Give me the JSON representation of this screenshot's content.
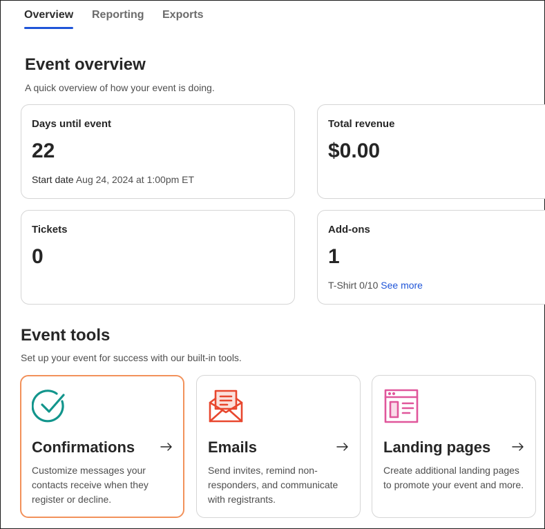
{
  "tabs": [
    {
      "label": "Overview",
      "active": true
    },
    {
      "label": "Reporting",
      "active": false
    },
    {
      "label": "Exports",
      "active": false
    }
  ],
  "overview": {
    "title": "Event overview",
    "subtitle": "A quick overview of how your event is doing.",
    "cards": {
      "days": {
        "label": "Days until event",
        "value": "22",
        "start_label": "Start date",
        "start_value": "Aug 24, 2024 at 1:00pm ET"
      },
      "revenue": {
        "label": "Total revenue",
        "value": "$0.00"
      },
      "tickets": {
        "label": "Tickets",
        "value": "0"
      },
      "addons": {
        "label": "Add-ons",
        "value": "1",
        "detail": "T-Shirt 0/10",
        "link": "See more"
      }
    }
  },
  "tools": {
    "title": "Event tools",
    "subtitle": "Set up your event for success with our built-in tools.",
    "items": [
      {
        "title": "Confirmations",
        "icon": "check-circle-icon",
        "desc": "Customize messages your contacts receive when they register or decline."
      },
      {
        "title": "Emails",
        "icon": "envelope-icon",
        "desc": "Send invites, remind non-responders, and communicate with registrants."
      },
      {
        "title": "Landing pages",
        "icon": "webpage-icon",
        "desc": "Create additional landing pages to promote your event and more."
      }
    ]
  },
  "colors": {
    "accent": "#1f55d8",
    "selected_border": "#f2915a",
    "teal": "#12958c",
    "email_red": "#e8472e",
    "pink": "#e0569b"
  }
}
